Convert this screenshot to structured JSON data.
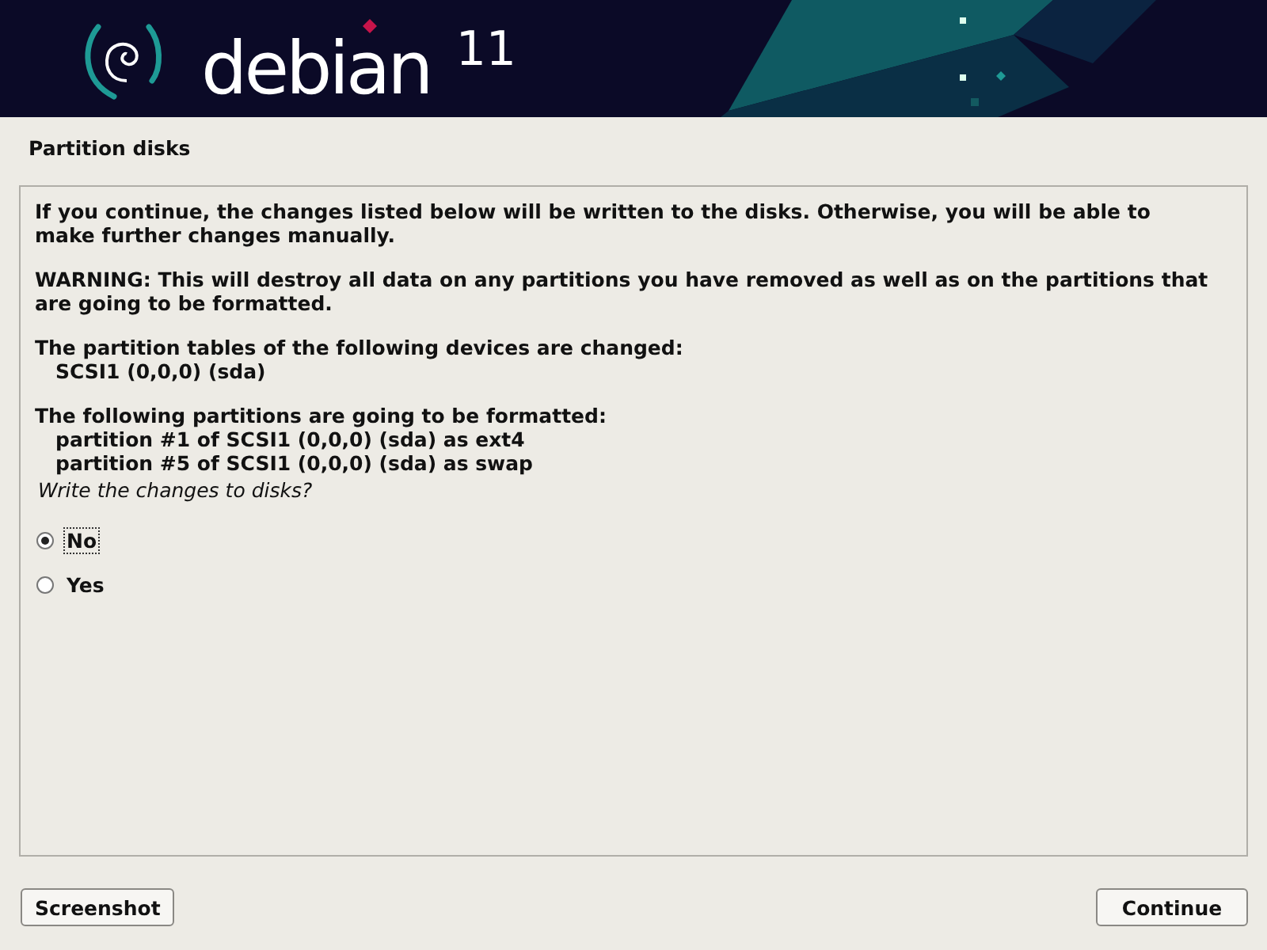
{
  "banner": {
    "brand": "debian",
    "version": "11"
  },
  "page_title": "Partition disks",
  "paragraphs": [
    {
      "text": "If you continue, the changes listed below will be written to the disks. Otherwise, you will be able to make further changes manually."
    },
    {
      "text": "WARNING: This will destroy all data on any partitions you have removed as well as on the partitions that are going to be formatted."
    },
    {
      "text": "The partition tables of the following devices are changed:",
      "items": [
        "SCSI1 (0,0,0) (sda)"
      ]
    },
    {
      "text": "The following partitions are going to be formatted:",
      "items": [
        "partition #1 of SCSI1 (0,0,0) (sda) as ext4",
        "partition #5 of SCSI1 (0,0,0) (sda) as swap"
      ]
    }
  ],
  "question": "Write the changes to disks?",
  "options": [
    {
      "label": "No",
      "selected": true
    },
    {
      "label": "Yes",
      "selected": false
    }
  ],
  "buttons": {
    "left": "Screenshot",
    "right": "Continue"
  }
}
